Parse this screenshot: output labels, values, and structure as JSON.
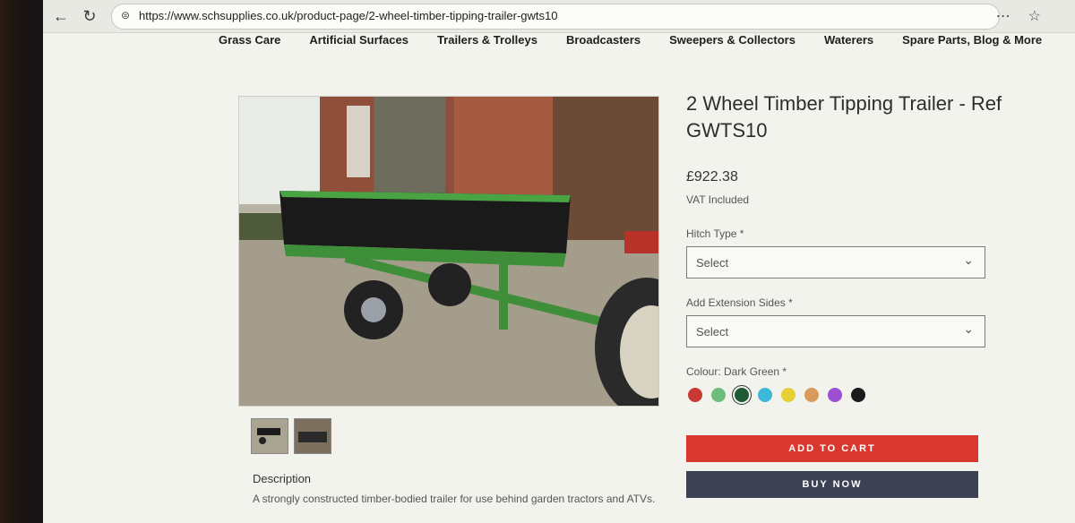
{
  "browser": {
    "url": "https://www.schsupplies.co.uk/product-page/2-wheel-timber-tipping-trailer-gwts10"
  },
  "nav": {
    "items": [
      "Grass Care",
      "Artificial Surfaces",
      "Trailers & Trolleys",
      "Broadcasters",
      "Sweepers & Collectors",
      "Waterers",
      "Spare Parts, Blog & More"
    ]
  },
  "product": {
    "title": "2 Wheel Timber Tipping Trailer - Ref GWTS10",
    "price": "£922.38",
    "vat": "VAT Included",
    "hitch_label": "Hitch Type *",
    "hitch_value": "Select",
    "extension_label": "Add Extension Sides *",
    "extension_value": "Select",
    "colour_label": "Colour: Dark Green *",
    "colours": [
      "#c93a35",
      "#6fbd7a",
      "#1f5a34",
      "#3cb8d9",
      "#e6d033",
      "#d99a5c",
      "#9b4fd3",
      "#1b1b1b"
    ],
    "selected_colour_index": 2,
    "add_to_cart": "ADD TO CART",
    "buy_now": "BUY NOW",
    "description_title": "Description",
    "description_text": "A strongly constructed timber-bodied trailer for use behind garden tractors and ATVs."
  }
}
